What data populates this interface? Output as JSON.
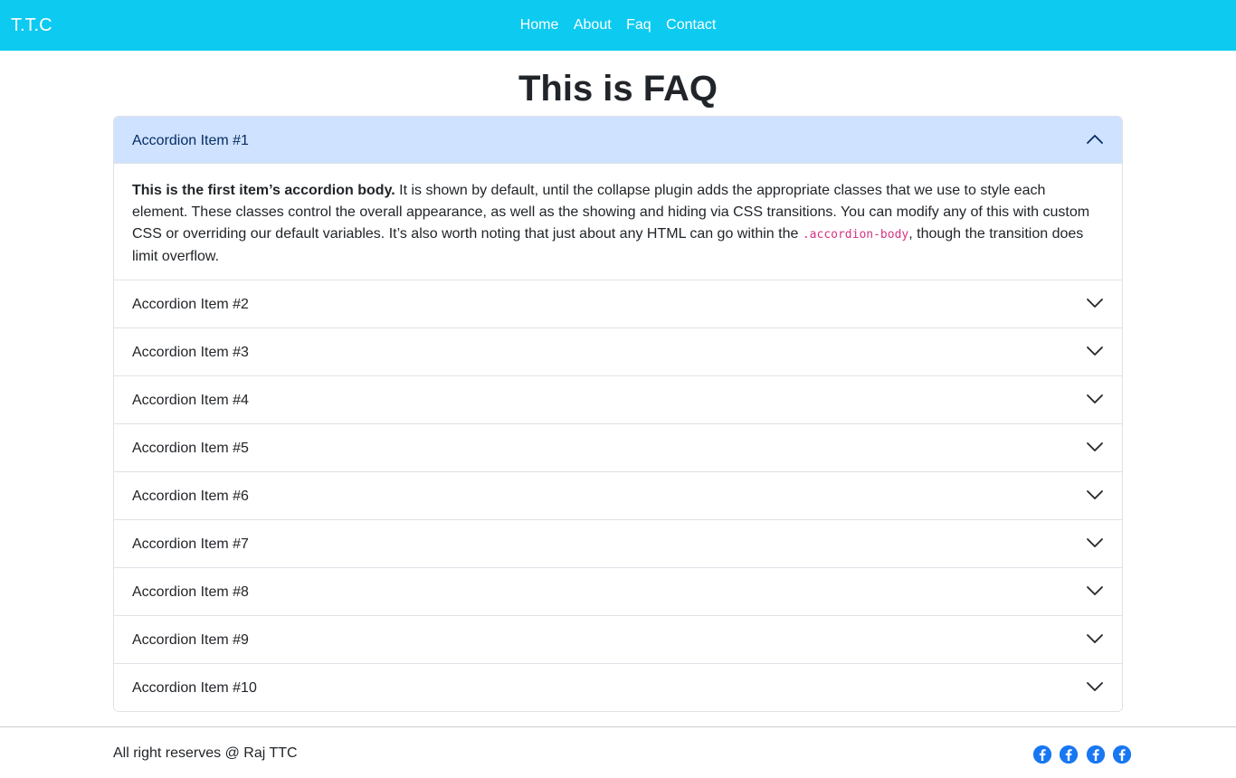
{
  "navbar": {
    "brand": "T.T.C",
    "links": [
      "Home",
      "About",
      "Faq",
      "Contact"
    ],
    "background": "#0dcaf0"
  },
  "page": {
    "title": "This is FAQ"
  },
  "accordion": {
    "items": [
      {
        "label": "Accordion Item #1",
        "expanded": true
      },
      {
        "label": "Accordion Item #2",
        "expanded": false
      },
      {
        "label": "Accordion Item #3",
        "expanded": false
      },
      {
        "label": "Accordion Item #4",
        "expanded": false
      },
      {
        "label": "Accordion Item #5",
        "expanded": false
      },
      {
        "label": "Accordion Item #6",
        "expanded": false
      },
      {
        "label": "Accordion Item #7",
        "expanded": false
      },
      {
        "label": "Accordion Item #8",
        "expanded": false
      },
      {
        "label": "Accordion Item #9",
        "expanded": false
      },
      {
        "label": "Accordion Item #10",
        "expanded": false
      }
    ],
    "body": {
      "bold_intro": "This is the first item’s accordion body.",
      "text_before_code": " It is shown by default, until the collapse plugin adds the appropriate classes that we use to style each element. These classes control the overall appearance, as well as the showing and hiding via CSS transitions. You can modify any of this with custom CSS or overriding our default variables. It’s also worth noting that just about any HTML can go within the ",
      "code": ".accordion-body",
      "text_after_code": ", though the transition does limit overflow."
    },
    "active_header_color": "#cfe2ff"
  },
  "footer": {
    "text": "All right reserves @ Raj TTC",
    "social_icons": [
      "facebook-icon",
      "facebook-icon",
      "facebook-icon",
      "facebook-icon"
    ],
    "icon_color": "#1877f2"
  }
}
